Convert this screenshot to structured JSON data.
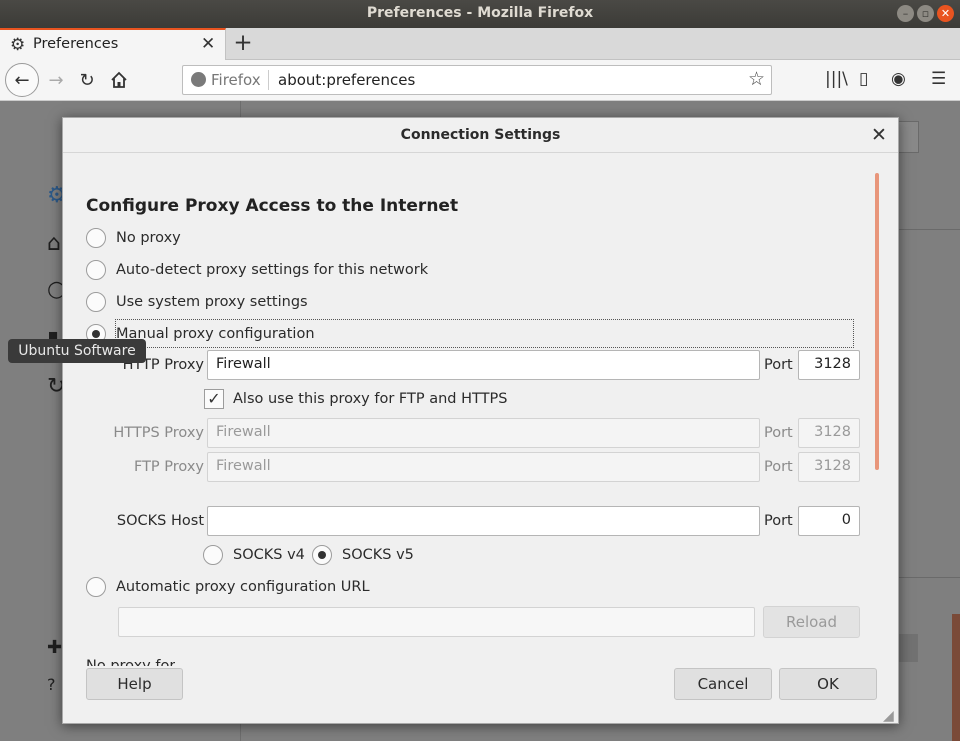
{
  "window": {
    "title": "Preferences - Mozilla Firefox"
  },
  "tabs": [
    {
      "label": "Preferences",
      "icon": "gear-icon",
      "active": true
    }
  ],
  "navbar": {
    "identity_label": "Firefox",
    "url": "about:preferences"
  },
  "tooltip": {
    "text": "Ubuntu Software"
  },
  "dialog": {
    "title": "Connection Settings",
    "section_title": "Configure Proxy Access to the Internet",
    "options": {
      "no_proxy": "No proxy",
      "auto_detect": "Auto-detect proxy settings for this network",
      "system": "Use system proxy settings",
      "manual": "Manual proxy configuration",
      "auto_url": "Automatic proxy configuration URL"
    },
    "selected_option": "manual",
    "http": {
      "label": "HTTP Proxy",
      "value": "Firewall",
      "port_label": "Port",
      "port": "3128"
    },
    "also_use": {
      "label": "Also use this proxy for FTP and HTTPS",
      "checked": true
    },
    "https": {
      "label": "HTTPS Proxy",
      "value": "Firewall",
      "port_label": "Port",
      "port": "3128"
    },
    "ftp": {
      "label": "FTP Proxy",
      "value": "Firewall",
      "port_label": "Port",
      "port": "3128"
    },
    "socks": {
      "label": "SOCKS Host",
      "value": "",
      "port_label": "Port",
      "port": "0",
      "v4_label": "SOCKS v4",
      "v5_label": "SOCKS v5",
      "selected_version": "v5"
    },
    "pac": {
      "value": "",
      "reload_label": "Reload"
    },
    "no_proxy_for_label": "No proxy for",
    "buttons": {
      "help": "Help",
      "cancel": "Cancel",
      "ok": "OK"
    }
  },
  "colors": {
    "accent": "#e95420",
    "titlebar": "#3c3b37"
  }
}
